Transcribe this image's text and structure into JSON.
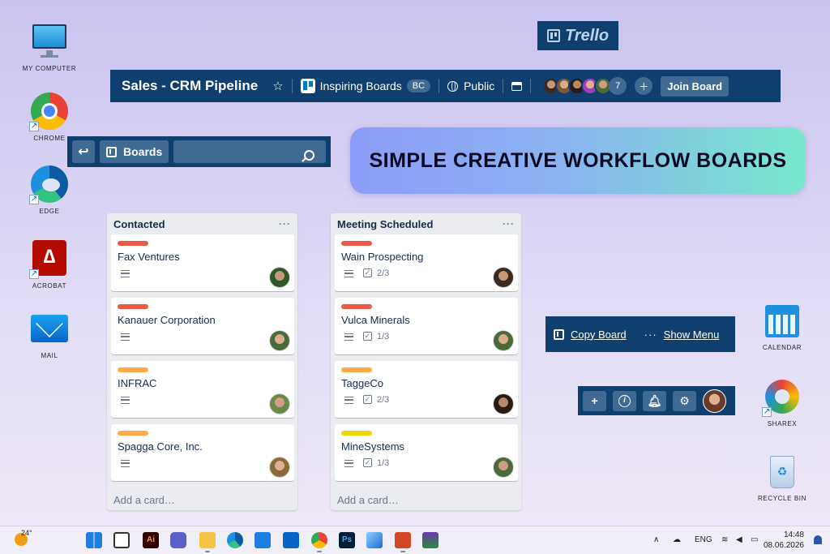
{
  "desktop": {
    "left_icons": [
      {
        "label": "MY COMPUTER",
        "icon": "monitor-icon"
      },
      {
        "label": "CHROME",
        "icon": "chrome-icon"
      },
      {
        "label": "EDGE",
        "icon": "edge-icon"
      },
      {
        "label": "ACROBAT",
        "icon": "acrobat-icon"
      },
      {
        "label": "MAIL",
        "icon": "mail-icon"
      }
    ],
    "right_icons": [
      {
        "label": "CALENDAR",
        "icon": "calendar-icon"
      },
      {
        "label": "SHAREX",
        "icon": "sharex-icon"
      },
      {
        "label": "RECYCLE BIN",
        "icon": "recycle-bin-icon"
      }
    ]
  },
  "trello_logo": {
    "text": "Trello"
  },
  "board_header": {
    "title": "Sales - CRM Pipeline",
    "workspace": "Inspiring Boards",
    "workspace_badge": "BC",
    "visibility": "Public",
    "member_extra_count": "7",
    "join_label": "Join Board"
  },
  "boards_bar": {
    "boards_label": "Boards",
    "search_value": ""
  },
  "banner": {
    "text": "SIMPLE CREATIVE WORKFLOW BOARDS"
  },
  "lists": [
    {
      "title": "Contacted",
      "menu": "···",
      "add_card": "Add a card…",
      "cards": [
        {
          "label_color": "#eb5a46",
          "title": "Fax Ventures",
          "checklist": ""
        },
        {
          "label_color": "#eb5a46",
          "title": "Kanauer Corporation",
          "checklist": ""
        },
        {
          "label_color": "#ffab4a",
          "title": "INFRAC",
          "checklist": ""
        },
        {
          "label_color": "#ffab4a",
          "title": "Spagga Core, Inc.",
          "checklist": ""
        }
      ]
    },
    {
      "title": "Meeting Scheduled",
      "menu": "···",
      "add_card": "Add a card…",
      "cards": [
        {
          "label_color": "#eb5a46",
          "title": "Wain Prospecting",
          "checklist": "2/3"
        },
        {
          "label_color": "#eb5a46",
          "title": "Vulca Minerals",
          "checklist": "1/3"
        },
        {
          "label_color": "#ffab4a",
          "title": "TaggeCo",
          "checklist": "2/3"
        },
        {
          "label_color": "#f2d600",
          "title": "MineSystems",
          "checklist": "1/3"
        }
      ]
    }
  ],
  "copy_bar": {
    "copy_label": "Copy Board",
    "dots": "···",
    "menu_label": "Show Menu"
  },
  "actions": {
    "add": "+",
    "info": "i",
    "notify": "bell-icon",
    "settings": "gear-icon"
  },
  "taskbar": {
    "temperature": "24°",
    "language": "ENG",
    "time": "14:48",
    "date": "08.06.2026",
    "apps": [
      "windows-icon",
      "terminal-icon",
      "illustrator-icon",
      "teams-icon",
      "file-explorer-icon",
      "edge-icon",
      "store-icon",
      "mail-icon",
      "chrome-icon",
      "photoshop-icon",
      "photos-icon",
      "powerpoint-icon",
      "media-icon"
    ]
  }
}
